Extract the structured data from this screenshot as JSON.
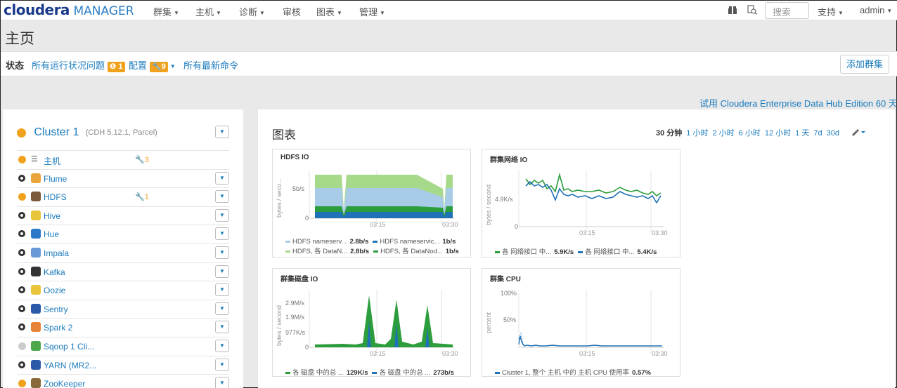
{
  "colors": {
    "accent": "#1a7bbd",
    "warning": "#f0a21e",
    "hdfs_light_green": "#a7d98a",
    "hdfs_light_blue": "#a8cce8",
    "dark_green": "#2c9d3c",
    "dark_blue": "#1f72b8"
  },
  "header": {
    "logo_cloudera": "cloudera",
    "logo_manager": "MANAGER",
    "nav": [
      {
        "label": "群集"
      },
      {
        "label": "主机"
      },
      {
        "label": "诊断"
      },
      {
        "label": "审核"
      },
      {
        "label": "图表"
      },
      {
        "label": "管理"
      }
    ],
    "icons": [
      "gift-icon",
      "search-stack-icon"
    ],
    "search_placeholder": "搜索",
    "support": "支持",
    "user": "admin"
  },
  "page_title": "主页",
  "tabs": {
    "status": "状态",
    "health_issues": "所有运行状况问题",
    "health_count": "1",
    "config": "配置",
    "config_count": "9",
    "recent_commands": "所有最新命令",
    "add_cluster": "添加群集"
  },
  "trial": "试用 Cloudera Enterprise Data Hub Edition 60 天",
  "cluster": {
    "name": "Cluster 1",
    "version": "(CDH 5.12.1, Parcel)",
    "services": [
      {
        "name": "主机",
        "status": "orange",
        "icon": "list-icon",
        "warn": "3",
        "dropdown": false
      },
      {
        "name": "Flume",
        "status": "ring",
        "icon": "flume-icon",
        "warn": "",
        "dropdown": true
      },
      {
        "name": "HDFS",
        "status": "orange",
        "icon": "hdfs-icon",
        "warn": "1",
        "dropdown": true
      },
      {
        "name": "Hive",
        "status": "ring",
        "icon": "hive-icon",
        "warn": "",
        "dropdown": true
      },
      {
        "name": "Hue",
        "status": "ring",
        "icon": "hue-icon",
        "warn": "",
        "dropdown": true
      },
      {
        "name": "Impala",
        "status": "ring",
        "icon": "impala-icon",
        "warn": "",
        "dropdown": true
      },
      {
        "name": "Kafka",
        "status": "ring",
        "icon": "kafka-icon",
        "warn": "",
        "dropdown": true
      },
      {
        "name": "Oozie",
        "status": "ring",
        "icon": "oozie-icon",
        "warn": "",
        "dropdown": true
      },
      {
        "name": "Sentry",
        "status": "ring",
        "icon": "sentry-icon",
        "warn": "",
        "dropdown": true
      },
      {
        "name": "Spark 2",
        "status": "ring",
        "icon": "spark-icon",
        "warn": "",
        "dropdown": true
      },
      {
        "name": "Sqoop 1 Cli...",
        "status": "grey",
        "icon": "sqoop-icon",
        "warn": "",
        "dropdown": true
      },
      {
        "name": "YARN (MR2...",
        "status": "ring",
        "icon": "yarn-icon",
        "warn": "",
        "dropdown": true
      },
      {
        "name": "ZooKeeper",
        "status": "orange",
        "icon": "zookeeper-icon",
        "warn": "",
        "dropdown": true
      }
    ]
  },
  "charts": {
    "title": "图表",
    "ranges": [
      "30 分钟",
      "1 小时",
      "2 小时",
      "6 小时",
      "12 小时",
      "1 天",
      "7d",
      "30d"
    ],
    "selected_range": "30 分钟",
    "hdfs": {
      "title": "HDFS IO",
      "ylabel": "bytes / seco...",
      "ytick": "5b/s",
      "xticks": [
        "03:15",
        "03:30"
      ],
      "legend": [
        {
          "label": "HDFS nameserv...",
          "value": "2.8b/s",
          "color": "#a8cce8"
        },
        {
          "label": "HDFS nameservic...",
          "value": "1b/s",
          "color": "#1f72b8"
        },
        {
          "label": "HDFS, 各 DataN...",
          "value": "2.8b/s",
          "color": "#a7d98a"
        },
        {
          "label": "HDFS, 各 DataNod...",
          "value": "1b/s",
          "color": "#2c9d3c"
        }
      ]
    },
    "net": {
      "title": "群集网络 IO",
      "ylabel": "bytes / second",
      "ytick": "4.9K/s",
      "xticks": [
        "03:15",
        "03:30"
      ],
      "legend": [
        {
          "label": "各 网络接口 中...",
          "value": "5.9K/s",
          "color": "#2c9d3c"
        },
        {
          "label": "各 网络接口 中...",
          "value": "5.4K/s",
          "color": "#1f72b8"
        }
      ]
    },
    "disk": {
      "title": "群集磁盘 IO",
      "ylabel": "bytes / second",
      "yticks": [
        "2.9M/s",
        "1.9M/s",
        "977K/s"
      ],
      "xticks": [
        "03:15",
        "03:30"
      ],
      "legend": [
        {
          "label": "各 磁盘 中的总 ...",
          "value": "129K/s",
          "color": "#2c9d3c"
        },
        {
          "label": "各 磁盘 中的总 ...",
          "value": "273b/s",
          "color": "#1f72b8"
        }
      ]
    },
    "cpu": {
      "title": "群集 CPU",
      "ylabel": "percent",
      "yticks": [
        "100%",
        "50%"
      ],
      "xticks": [
        "03:15",
        "03:30"
      ],
      "legend": [
        {
          "label": "Cluster 1, 整个 主机 中的 主机 CPU 使用率",
          "value": "0.57%",
          "color": "#1f72b8"
        }
      ]
    }
  }
}
